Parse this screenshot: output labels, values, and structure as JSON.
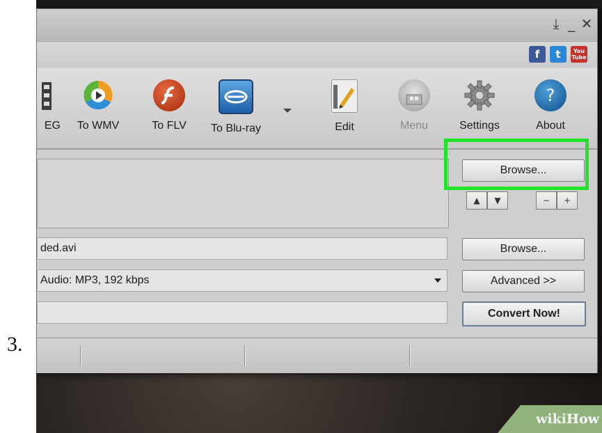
{
  "step": "3.",
  "window": {
    "controls": {
      "download": "⤓",
      "minimize": "_",
      "close": "✕"
    }
  },
  "social": {
    "facebook": "f",
    "twitter": "t",
    "youtube_top": "You",
    "youtube_bottom": "Tube"
  },
  "toolbar": {
    "items": [
      {
        "label": "EG",
        "icon": "film-icon"
      },
      {
        "label": "To WMV",
        "icon": "wmv-icon"
      },
      {
        "label": "To FLV",
        "icon": "flash-icon"
      },
      {
        "label": "To Blu-ray",
        "icon": "bluray-icon"
      },
      {
        "label": "Edit",
        "icon": "edit-icon"
      },
      {
        "label": "Menu",
        "icon": "menu-icon"
      },
      {
        "label": "Settings",
        "icon": "gear-icon"
      },
      {
        "label": "About",
        "icon": "help-icon"
      }
    ]
  },
  "input": {
    "browse_label": "Browse...",
    "up": "▲",
    "down": "▼",
    "minus": "−",
    "plus": "+"
  },
  "output": {
    "file_value": "ded.avi",
    "browse_label": "Browse...",
    "format_value": "Audio: MP3, 192 kbps",
    "advanced_label": "Advanced >>",
    "convert_label": "Convert Now!"
  },
  "watermark": {
    "wiki": "wiki",
    "how": "How"
  },
  "colors": {
    "highlight": "#22e22a",
    "wikihow_green": "#8fb37a"
  }
}
